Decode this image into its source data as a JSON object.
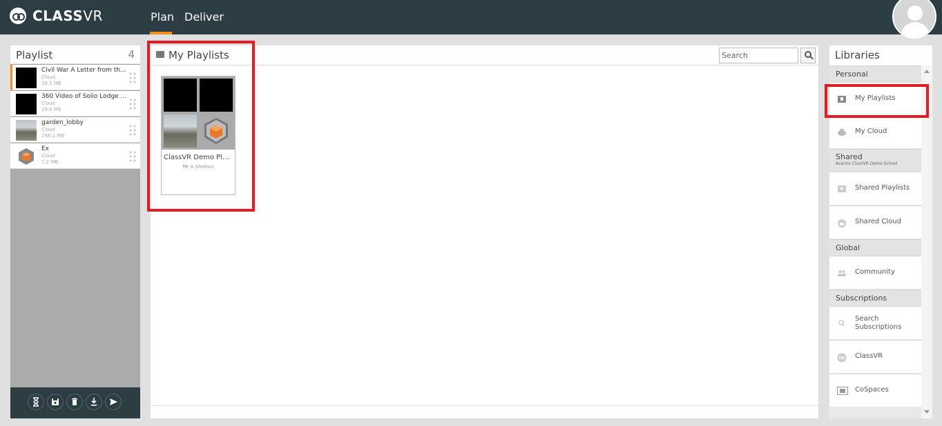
{
  "brand": {
    "name_bold": "CLASS",
    "name_light": "VR",
    "accent": "#f0901e",
    "header_bg": "#2c3e44",
    "highlight": "#e31b23"
  },
  "nav": {
    "tabs": [
      {
        "label": "Plan",
        "active": true
      },
      {
        "label": "Deliver",
        "active": false
      }
    ]
  },
  "user": {
    "avatar_icon": "user-avatar-icon"
  },
  "playlist": {
    "title": "Playlist",
    "count": "4",
    "items": [
      {
        "name": "Civil War A Letter from th...",
        "source": "Cloud",
        "size": "28.1 MB",
        "thumb": "black"
      },
      {
        "name": "360 Video of Solio Lodge ...",
        "source": "Cloud",
        "size": "19.6 MB",
        "thumb": "black"
      },
      {
        "name": "garden_lobby",
        "source": "Cloud",
        "size": "248.1 MB",
        "thumb": "panorama"
      },
      {
        "name": "Ex",
        "source": "Cloud",
        "size": "7.2 MB",
        "thumb": "cube"
      }
    ],
    "toolbar": [
      "hourglass-icon",
      "save-icon",
      "trash-icon",
      "download-icon",
      "send-icon"
    ]
  },
  "main": {
    "title": "My Playlists",
    "search": {
      "placeholder": "Search",
      "value": ""
    },
    "cards": [
      {
        "name": "ClassVR Demo Pla...",
        "owner": "Mr A Shelton"
      }
    ]
  },
  "libraries": {
    "title": "Libraries",
    "sections": {
      "personal": "Personal",
      "shared": "Shared",
      "shared_sub": "Avantis ClassVR Demo School",
      "global": "Global",
      "subscriptions": "Subscriptions"
    },
    "items": {
      "my_playlists": "My Playlists",
      "my_cloud": "My Cloud",
      "shared_playlists": "Shared Playlists",
      "shared_cloud": "Shared Cloud",
      "community": "Community",
      "search_subscriptions_1": "Search",
      "search_subscriptions_2": "Subscriptions",
      "classvr": "ClassVR",
      "cospaces": "CoSpaces"
    }
  }
}
